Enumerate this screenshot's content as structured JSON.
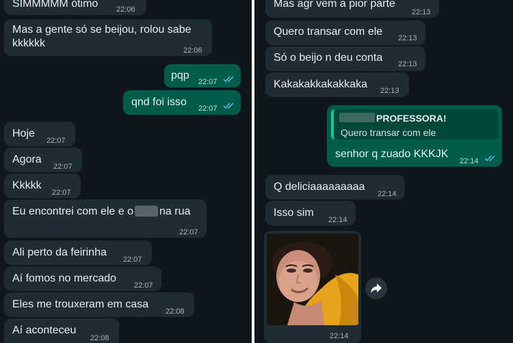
{
  "left": {
    "messages": [
      {
        "text": "SIMMMMM ótimo",
        "time": "22:06"
      },
      {
        "line1": "Mas a gente só se beijou, rolou sabe",
        "line2": "kkkkkk",
        "time": "22:06"
      },
      {
        "text": "pqp",
        "time": "22:07"
      },
      {
        "text": "qnd foi isso",
        "time": "22:07"
      },
      {
        "text": "Hoje",
        "time": "22:07"
      },
      {
        "text": "Agora",
        "time": "22:07"
      },
      {
        "text": "Kkkkk",
        "time": "22:07"
      },
      {
        "text_before": "Eu encontrei com ele e o",
        "text_after": "na rua",
        "time": "22:07"
      },
      {
        "text": "Ali perto da feirinha",
        "time": "22:07"
      },
      {
        "text": "Aí fomos no mercado",
        "time": "22:07"
      },
      {
        "text": "Eles me trouxeram em casa",
        "time": "22:08"
      },
      {
        "text": "Aí aconteceu",
        "time": "22:08"
      }
    ]
  },
  "right": {
    "messages": [
      {
        "text": "Mas agr vem a pior parte",
        "time": "22:13"
      },
      {
        "text": "Quero transar com ele",
        "time": "22:13"
      },
      {
        "text": "Só o beijo n deu conta",
        "time": "22:13"
      },
      {
        "text": "Kakakakkakakkaka",
        "time": "22:13"
      },
      {
        "quote_name": "PROFESSORA!",
        "quote_text": "Quero transar com ele",
        "text": "senhor q zuado KKKJK",
        "time": "22:14"
      },
      {
        "text": "Q deliciaaaaaaaaa",
        "time": "22:14"
      },
      {
        "text": "Isso sim",
        "time": "22:14"
      },
      {
        "time": "22:14"
      }
    ]
  },
  "colors": {
    "background": "#0f171c",
    "incoming_bubble": "#1f2c33",
    "outgoing_bubble": "#005c4b",
    "read_ticks": "#53bdeb"
  },
  "icons": [
    "double-check-icon",
    "forward-icon"
  ]
}
